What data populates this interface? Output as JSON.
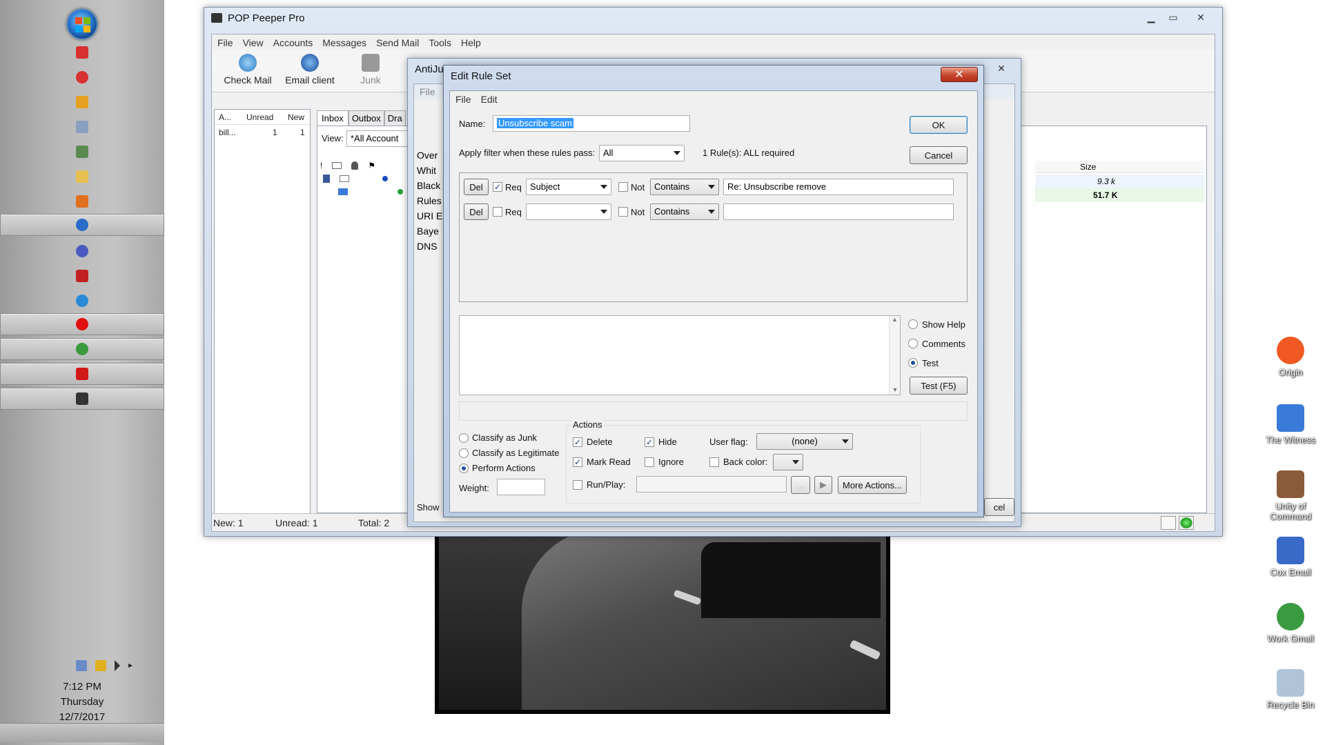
{
  "taskbar": {
    "clock_time": "7:12 PM",
    "clock_day": "Thursday",
    "clock_date": "12/7/2017",
    "items": [
      {
        "icon": "x-circle-icon",
        "color": "#d83030"
      },
      {
        "icon": "shield-icon",
        "color": "#d83030"
      },
      {
        "icon": "chart-icon",
        "color": "#e6a020"
      },
      {
        "icon": "document-icon",
        "color": "#8aa0c0"
      },
      {
        "icon": "network-icon",
        "color": "#5a8a50"
      },
      {
        "icon": "folder-icon",
        "color": "#e6c050"
      },
      {
        "icon": "media-icon",
        "color": "#e07020"
      },
      {
        "icon": "mail-icon",
        "color": "#2a6ac8"
      },
      {
        "icon": "help-icon",
        "color": "#4a5ac0"
      },
      {
        "icon": "pdf-icon",
        "color": "#c02020"
      },
      {
        "icon": "ie-icon",
        "color": "#2a8ad8"
      },
      {
        "icon": "opera-icon",
        "color": "#e01010"
      },
      {
        "icon": "chrome-icon",
        "color": "#3a9a40"
      },
      {
        "icon": "maple-leaf-icon",
        "color": "#d01818"
      },
      {
        "icon": "pop-peeper-icon",
        "color": "#333333"
      }
    ]
  },
  "desktop_icons": [
    {
      "label": "Origin",
      "icon": "origin-icon",
      "color": "#f05a22"
    },
    {
      "label": "The Witness",
      "icon": "witness-icon",
      "color": "#3a7ad8"
    },
    {
      "label": "Unity of Command",
      "icon": "unity-icon",
      "color": "#8a5a3a"
    },
    {
      "label": "Cox Email",
      "icon": "cox-email-icon",
      "color": "#3a6ac8"
    },
    {
      "label": "Work Gmail",
      "icon": "chrome-icon",
      "color": "#3a9a40"
    },
    {
      "label": "Recycle Bin",
      "icon": "recycle-bin-icon",
      "color": "#b0c4d8"
    }
  ],
  "main_window": {
    "title": "POP Peeper Pro",
    "menu": [
      "File",
      "View",
      "Accounts",
      "Messages",
      "Send Mail",
      "Tools",
      "Help"
    ],
    "toolbar": {
      "check_mail": "Check Mail",
      "email_client": "Email client",
      "junk": "Junk"
    },
    "accounts_headers": [
      "A...",
      "Unread",
      "New"
    ],
    "accounts_row": [
      "bill...",
      "1",
      "1"
    ],
    "tabs": [
      "Inbox",
      "Outbox",
      "Dra"
    ],
    "view_label": "View:",
    "view_value": "*All Account",
    "size_header": "Size",
    "sizes": [
      "9.3 k",
      "51.7 K"
    ],
    "status": {
      "new": "New: 1",
      "unread": "Unread: 1",
      "total": "Total: 2"
    }
  },
  "antijunk_window": {
    "title": "AntiJu",
    "menu": "File",
    "list": [
      "Over",
      "Whit",
      "Black",
      "Rules",
      "URI E",
      "Baye",
      "DNS"
    ],
    "show_label": "Show",
    "cancel_partial": "cel"
  },
  "edit_dialog": {
    "title": "Edit Rule Set",
    "menu": [
      "File",
      "Edit"
    ],
    "name_label": "Name:",
    "name_value": "Unsubscribe scam",
    "ok": "OK",
    "cancel": "Cancel",
    "apply_label": "Apply filter when these rules pass:",
    "apply_value": "All",
    "rules_summary": "1 Rule(s): ALL required",
    "rules": [
      {
        "del": "Del",
        "req_label": "Req",
        "req": true,
        "field": "Subject",
        "not_label": "Not",
        "not": false,
        "op": "Contains",
        "value": "Re: Unsubscribe remove"
      },
      {
        "del": "Del",
        "req_label": "Req",
        "req": false,
        "field": "",
        "not_label": "Not",
        "not": false,
        "op": "Contains",
        "value": ""
      }
    ],
    "help_options": {
      "show_help": "Show Help",
      "comments": "Comments",
      "test": "Test",
      "selected": "Test"
    },
    "test_button": "Test (F5)",
    "classify": {
      "junk": "Classify as Junk",
      "legit": "Classify as Legitimate",
      "perform": "Perform Actions",
      "selected": "Perform Actions"
    },
    "weight_label": "Weight:",
    "weight_value": "",
    "actions": {
      "title": "Actions",
      "delete": "Delete",
      "delete_checked": true,
      "hide": "Hide",
      "hide_checked": true,
      "mark_read": "Mark Read",
      "mark_read_checked": true,
      "ignore": "Ignore",
      "ignore_checked": false,
      "user_flag_label": "User flag:",
      "user_flag_value": "(none)",
      "back_color_label": "Back color:",
      "back_color_checked": false,
      "run_play": "Run/Play:",
      "run_play_checked": false,
      "more_actions": "More Actions..."
    }
  }
}
